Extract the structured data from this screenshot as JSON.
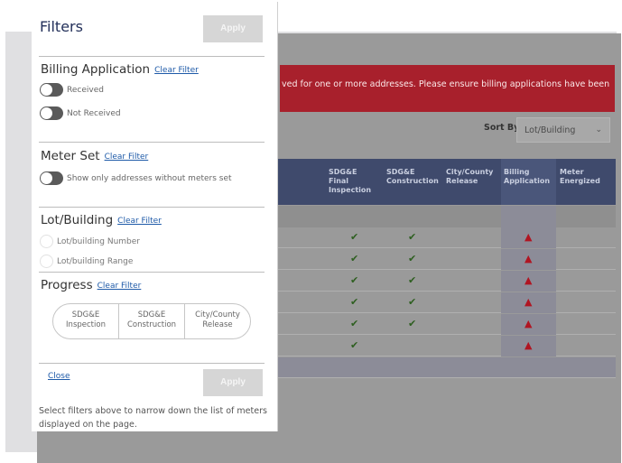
{
  "banner": {
    "text": "ved for one or more addresses. Please ensure billing applications have been"
  },
  "sort": {
    "label": "Sort By",
    "selected": "Lot/Building"
  },
  "table": {
    "headers": [
      {
        "lines": [
          "SDG&E",
          "Final",
          "Inspection"
        ]
      },
      {
        "lines": [
          "SDG&E",
          "Construction"
        ]
      },
      {
        "lines": [
          "City/County",
          "Release"
        ]
      },
      {
        "lines": [
          "Billing",
          "Application"
        ]
      },
      {
        "lines": [
          "Meter",
          "Energized"
        ]
      }
    ],
    "rows": [
      {
        "final": "✔",
        "construction": "✔",
        "billing": "▲"
      },
      {
        "final": "✔",
        "construction": "✔",
        "billing": "▲"
      },
      {
        "final": "✔",
        "construction": "✔",
        "billing": "▲"
      },
      {
        "final": "✔",
        "construction": "✔",
        "billing": "▲"
      },
      {
        "final": "✔",
        "construction": "✔",
        "billing": "▲"
      },
      {
        "final": "✔",
        "construction": "",
        "billing": "▲"
      }
    ]
  },
  "filters": {
    "title": "Filters",
    "apply_label": "Apply",
    "clear_label": "Clear Filter",
    "billing": {
      "title": "Billing Application",
      "options": [
        "Received",
        "Not Received"
      ]
    },
    "meter": {
      "title": "Meter Set",
      "option": "Show only addresses without meters set"
    },
    "lot": {
      "title": "Lot/Building",
      "options": [
        "Lot/building Number",
        "Lot/building Range"
      ]
    },
    "progress": {
      "title": "Progress",
      "segments": [
        {
          "line1": "SDG&E",
          "line2": "Inspection"
        },
        {
          "line1": "SDG&E",
          "line2": "Construction"
        },
        {
          "line1": "City/County",
          "line2": "Release"
        }
      ]
    },
    "close_label": "Close",
    "help_text": "Select filters above to narrow down the list of meters displayed on the page."
  },
  "colors": {
    "header": "#3f4a6c",
    "banner": "#a8202c",
    "check": "#2e5f20",
    "warning": "#b01522",
    "link": "#1e5aa8"
  }
}
